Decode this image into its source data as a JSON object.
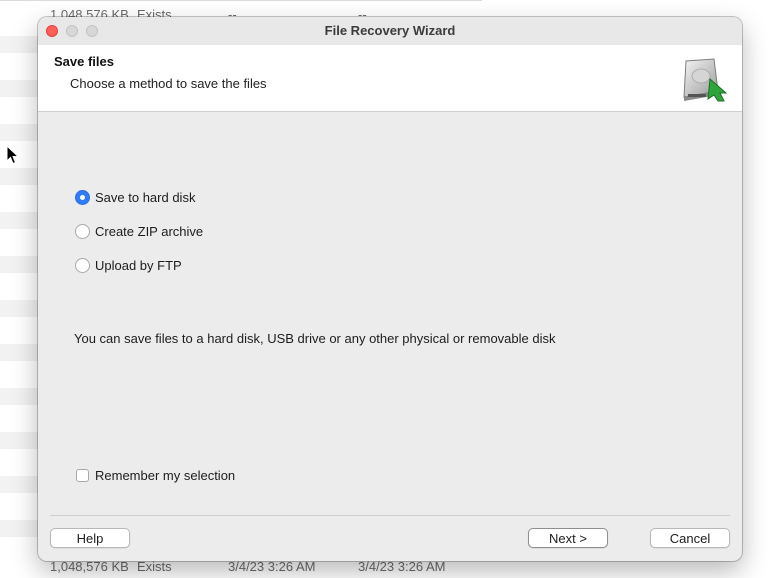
{
  "background_app": {
    "top_row": {
      "size": "1,048,576 KB",
      "status": "Exists",
      "created": "--",
      "modified": "--"
    },
    "bottom_row": {
      "size": "1,048,576 KB",
      "status": "Exists",
      "created": "3/4/23 3:26 AM",
      "modified": "3/4/23 3:26 AM"
    }
  },
  "window": {
    "title": "File Recovery Wizard"
  },
  "header": {
    "title": "Save files",
    "subtitle": "Choose a method to save the files",
    "icon": "hard-disk-with-arrow-icon"
  },
  "save_methods": {
    "selected": "Save to hard disk",
    "options": [
      {
        "label": "Save to hard disk",
        "checked": true
      },
      {
        "label": "Create ZIP archive",
        "checked": false
      },
      {
        "label": "Upload by FTP",
        "checked": false
      }
    ]
  },
  "description": "You can save files to a hard disk, USB drive or any other physical or removable disk",
  "remember": {
    "label": "Remember my selection",
    "checked": false
  },
  "buttons": {
    "help": "Help",
    "next": "Next >",
    "cancel": "Cancel"
  },
  "colors": {
    "accent": "#2f7cf6",
    "close": "#ff5f57",
    "dialog_bg": "#ececec"
  }
}
